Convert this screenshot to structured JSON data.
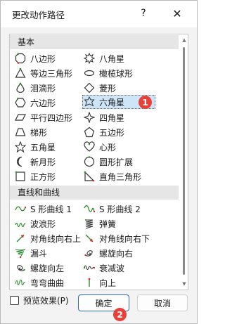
{
  "window": {
    "title": "更改动作路径",
    "help_label": "?",
    "close_label": "✕"
  },
  "categories": [
    {
      "label": "基本"
    },
    {
      "label": "直线和曲线"
    }
  ],
  "items": [
    {
      "label": "八边形",
      "icon": "octagon-icon"
    },
    {
      "label": "八角星",
      "icon": "eight-point-star-icon"
    },
    {
      "label": "等边三角形",
      "icon": "equilateral-triangle-icon"
    },
    {
      "label": "橄榄球形",
      "icon": "football-icon"
    },
    {
      "label": "泪滴形",
      "icon": "teardrop-icon"
    },
    {
      "label": "菱形",
      "icon": "diamond-icon"
    },
    {
      "label": "六边形",
      "icon": "hexagon-icon"
    },
    {
      "label": "六角星",
      "icon": "six-point-star-icon"
    },
    {
      "label": "平行四边形",
      "icon": "parallelogram-icon"
    },
    {
      "label": "四角星",
      "icon": "four-point-star-icon"
    },
    {
      "label": "梯形",
      "icon": "trapezoid-icon"
    },
    {
      "label": "五边形",
      "icon": "pentagon-icon"
    },
    {
      "label": "五角星",
      "icon": "five-point-star-icon"
    },
    {
      "label": "心形",
      "icon": "heart-icon"
    },
    {
      "label": "新月形",
      "icon": "crescent-icon"
    },
    {
      "label": "圆形扩展",
      "icon": "circle-icon"
    },
    {
      "label": "正方形",
      "icon": "square-icon"
    },
    {
      "label": "直角三角形",
      "icon": "right-triangle-icon"
    },
    {
      "label": "S 形曲线 1",
      "icon": "s-curve-1-icon"
    },
    {
      "label": "S 形曲线 2",
      "icon": "s-curve-2-icon"
    },
    {
      "label": "波浪形",
      "icon": "wave-icon"
    },
    {
      "label": "弹簧",
      "icon": "spring-icon"
    },
    {
      "label": "对角线向右上",
      "icon": "diagonal-up-right-icon"
    },
    {
      "label": "对角线向右下",
      "icon": "diagonal-down-right-icon"
    },
    {
      "label": "漏斗",
      "icon": "funnel-icon"
    },
    {
      "label": "螺旋向右",
      "icon": "spiral-right-icon"
    },
    {
      "label": "螺旋向左",
      "icon": "spiral-left-icon"
    },
    {
      "label": "衰减波",
      "icon": "decaying-wave-icon"
    },
    {
      "label": "弯弯曲曲",
      "icon": "zigzag-curve-icon"
    },
    {
      "label": "向上",
      "icon": "up-line-icon"
    }
  ],
  "selected_item": "六角星",
  "annotations": [
    "1",
    "2"
  ],
  "footer": {
    "preview_label": "预览效果(P)",
    "preview_checked": false,
    "ok_label": "确定",
    "cancel_label": "取消"
  },
  "colors": {
    "path_green": "#2e8b2e",
    "path_red": "#d32f2f",
    "badge_red": "#e8413a",
    "selection": "#cde5f7"
  }
}
